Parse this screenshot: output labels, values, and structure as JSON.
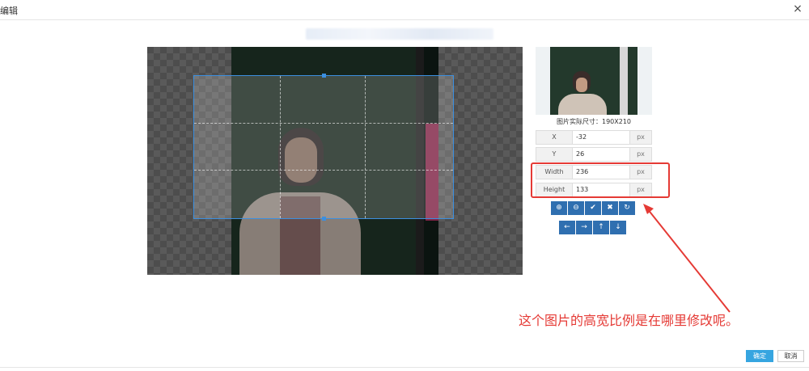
{
  "dialog": {
    "title": "编辑",
    "close_glyph": "×"
  },
  "preview": {
    "size_text": "图片实际尺寸：190X210"
  },
  "fields": [
    {
      "label": "X",
      "value": "-32",
      "unit": "px"
    },
    {
      "label": "Y",
      "value": "26",
      "unit": "px"
    },
    {
      "label": "Width",
      "value": "236",
      "unit": "px"
    },
    {
      "label": "Height",
      "value": "133",
      "unit": "px"
    }
  ],
  "toolbar_row1": [
    {
      "name": "zoom-in-icon",
      "glyph": "⊕"
    },
    {
      "name": "zoom-out-icon",
      "glyph": "⊖"
    },
    {
      "name": "check-icon",
      "glyph": "✔"
    },
    {
      "name": "cross-icon",
      "glyph": "✖"
    },
    {
      "name": "refresh-icon",
      "glyph": "↻"
    }
  ],
  "toolbar_row2": [
    {
      "name": "arrow-left-icon",
      "glyph": "←"
    },
    {
      "name": "arrow-right-icon",
      "glyph": "→"
    },
    {
      "name": "arrow-up-icon",
      "glyph": "↑"
    },
    {
      "name": "arrow-down-icon",
      "glyph": "↓"
    }
  ],
  "annotation": {
    "text": "这个图片的高宽比例是在哪里修改呢。",
    "color": "#e53a35"
  },
  "footer": {
    "ok_label": "确定",
    "cancel_label": "取消"
  },
  "colors": {
    "accent": "#36a5e0",
    "toolbar": "#2f6fb0",
    "crop": "#3b8fe0"
  }
}
